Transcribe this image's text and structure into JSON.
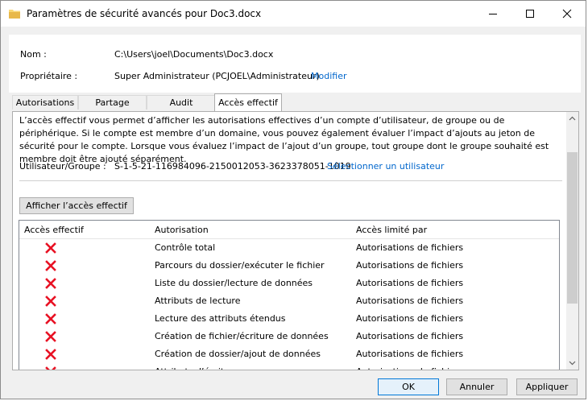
{
  "window": {
    "title": "Paramètres de sécurité avancés pour Doc3.docx"
  },
  "info": {
    "name_label": "Nom :",
    "name_value": "C:\\Users\\joel\\Documents\\Doc3.docx",
    "owner_label": "Propriétaire :",
    "owner_value": "Super Administrateur (PCJOEL\\Administrateur)",
    "owner_link": "Modifier"
  },
  "tabs": [
    {
      "label": "Autorisations"
    },
    {
      "label": "Partage"
    },
    {
      "label": "Audit"
    },
    {
      "label": "Accès effectif",
      "active": true
    }
  ],
  "effective": {
    "description": "L’accès effectif vous permet d’afficher les autorisations effectives d’un compte d’utilisateur, de groupe ou de périphérique. Si le compte est membre d’un domaine, vous pouvez également évaluer l’impact d’ajouts au jeton de sécurité pour le compte. Lorsque vous évaluez l’impact de l’ajout d’un groupe, tout groupe dont le groupe souhaité est membre doit être ajouté séparément.",
    "user_label": "Utilisateur/Groupe :",
    "user_value": "S-1-5-21-116984096-2150012053-3623378051-1019",
    "select_user_link": "Sélectionner un utilisateur",
    "show_button": "Afficher l’accès effectif"
  },
  "table": {
    "headers": [
      "Accès effectif",
      "Autorisation",
      "Accès limité par"
    ],
    "rows": [
      {
        "access": "denied",
        "permission": "Contrôle total",
        "limited_by": "Autorisations de fichiers"
      },
      {
        "access": "denied",
        "permission": "Parcours du dossier/exécuter le fichier",
        "limited_by": "Autorisations de fichiers"
      },
      {
        "access": "denied",
        "permission": "Liste du dossier/lecture de données",
        "limited_by": "Autorisations de fichiers"
      },
      {
        "access": "denied",
        "permission": "Attributs de lecture",
        "limited_by": "Autorisations de fichiers"
      },
      {
        "access": "denied",
        "permission": "Lecture des attributs étendus",
        "limited_by": "Autorisations de fichiers"
      },
      {
        "access": "denied",
        "permission": "Création de fichier/écriture de données",
        "limited_by": "Autorisations de fichiers"
      },
      {
        "access": "denied",
        "permission": "Création de dossier/ajout de données",
        "limited_by": "Autorisations de fichiers"
      },
      {
        "access": "denied",
        "permission": "Attributs d’écriture",
        "limited_by": "Autorisations de fichiers"
      }
    ]
  },
  "buttons": {
    "ok": "OK",
    "cancel": "Annuler",
    "apply": "Appliquer"
  },
  "colors": {
    "link": "#0066cc",
    "deny": "#e81123",
    "accent": "#0078d7"
  },
  "icons": {
    "title": "folder-icon",
    "deny": "red-x-icon"
  }
}
